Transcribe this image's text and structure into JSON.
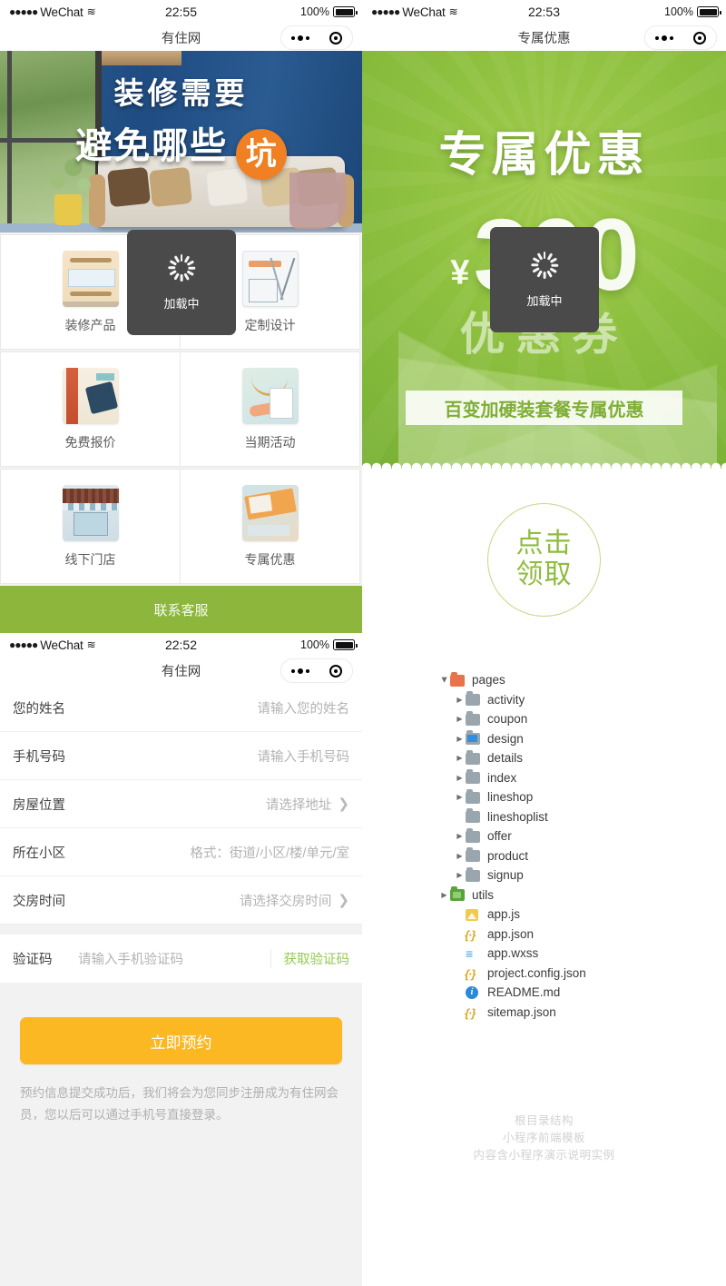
{
  "status_bar": {
    "signal_dots": "●●●●●",
    "carrier": "WeChat",
    "wifi_glyph": "≋",
    "battery_pct": "100%"
  },
  "screens": {
    "home": {
      "time": "22:55",
      "nav_title": "有住网"
    },
    "coupon": {
      "time": "22:53",
      "nav_title": "专属优惠"
    },
    "signup": {
      "time": "22:52",
      "nav_title": "有住网"
    }
  },
  "hero": {
    "line1": "装修需要",
    "line2": "避免哪些",
    "badge": "坑"
  },
  "grid": [
    {
      "label": "装修产品",
      "icon": "furniture-icon"
    },
    {
      "label": "定制设计",
      "icon": "compass-icon"
    },
    {
      "label": "免费报价",
      "icon": "calculator-icon"
    },
    {
      "label": "当期活动",
      "icon": "clipboard-icon"
    },
    {
      "label": "线下门店",
      "icon": "storefront-icon"
    },
    {
      "label": "专属优惠",
      "icon": "coupon-icon"
    }
  ],
  "toast": {
    "label": "加载中"
  },
  "contact_bar": {
    "label": "联系客服"
  },
  "form": {
    "rows": [
      {
        "label": "您的姓名",
        "value": "请输入您的姓名",
        "chevron": false
      },
      {
        "label": "手机号码",
        "value": "请输入手机号码",
        "chevron": false
      },
      {
        "label": "房屋位置",
        "value": "请选择地址",
        "chevron": true
      },
      {
        "label": "所在小区",
        "value": "格式：街道/小区/楼/单元/室",
        "chevron": false
      },
      {
        "label": "交房时间",
        "value": "请选择交房时间",
        "chevron": true
      }
    ],
    "code": {
      "label": "验证码",
      "placeholder": "请输入手机验证码",
      "button": "获取验证码",
      "button_color": "#93c94f"
    },
    "submit": {
      "label": "立即预约",
      "color": "#fcb823"
    },
    "note": "预约信息提交成功后，我们将会为您同步注册成为有住网会员，您以后可以通过手机号直接登录。"
  },
  "coupon_banner": {
    "title": "专属优惠",
    "currency": "¥",
    "amount": "300",
    "subtitle": "优惠券",
    "ribbon": "百变加硬装套餐专属优惠",
    "accent": "#8fc140"
  },
  "claim": {
    "line1": "点击",
    "line2": "领取",
    "color": "#8fbc3f"
  },
  "file_tree": [
    {
      "depth": 0,
      "name": "pages",
      "type": "folder",
      "icon": "folder-orange-icon",
      "arrow": "open"
    },
    {
      "depth": 1,
      "name": "activity",
      "type": "folder",
      "icon": "folder-gray-icon",
      "arrow": "closed"
    },
    {
      "depth": 1,
      "name": "coupon",
      "type": "folder",
      "icon": "folder-gray-icon",
      "arrow": "closed"
    },
    {
      "depth": 1,
      "name": "design",
      "type": "folder",
      "icon": "folder-blue-icon",
      "arrow": "closed"
    },
    {
      "depth": 1,
      "name": "details",
      "type": "folder",
      "icon": "folder-gray-icon",
      "arrow": "closed"
    },
    {
      "depth": 1,
      "name": "index",
      "type": "folder",
      "icon": "folder-gray-icon",
      "arrow": "closed"
    },
    {
      "depth": 1,
      "name": "lineshop",
      "type": "folder",
      "icon": "folder-gray-icon",
      "arrow": "closed"
    },
    {
      "depth": 1,
      "name": "lineshoplist",
      "type": "folder",
      "icon": "folder-gray-icon",
      "arrow": "none"
    },
    {
      "depth": 1,
      "name": "offer",
      "type": "folder",
      "icon": "folder-gray-icon",
      "arrow": "closed"
    },
    {
      "depth": 1,
      "name": "product",
      "type": "folder",
      "icon": "folder-gray-icon",
      "arrow": "closed"
    },
    {
      "depth": 1,
      "name": "signup",
      "type": "folder",
      "icon": "folder-gray-icon",
      "arrow": "closed"
    },
    {
      "depth": 0,
      "name": "utils",
      "type": "folder",
      "icon": "folder-green-icon",
      "arrow": "closed"
    },
    {
      "depth": 1,
      "name": "app.js",
      "type": "js",
      "icon": "js-file-icon",
      "arrow": "none"
    },
    {
      "depth": 1,
      "name": "app.json",
      "type": "json",
      "icon": "json-file-icon",
      "arrow": "none"
    },
    {
      "depth": 1,
      "name": "app.wxss",
      "type": "wxss",
      "icon": "wxss-file-icon",
      "arrow": "none"
    },
    {
      "depth": 1,
      "name": "project.config.json",
      "type": "json",
      "icon": "json-file-icon",
      "arrow": "none"
    },
    {
      "depth": 1,
      "name": "README.md",
      "type": "md",
      "icon": "info-file-icon",
      "arrow": "none"
    },
    {
      "depth": 1,
      "name": "sitemap.json",
      "type": "json",
      "icon": "json-file-icon",
      "arrow": "none"
    }
  ],
  "watermark": [
    "根目录结构",
    "小程序前端模板",
    "内容含小程序演示说明实例"
  ]
}
